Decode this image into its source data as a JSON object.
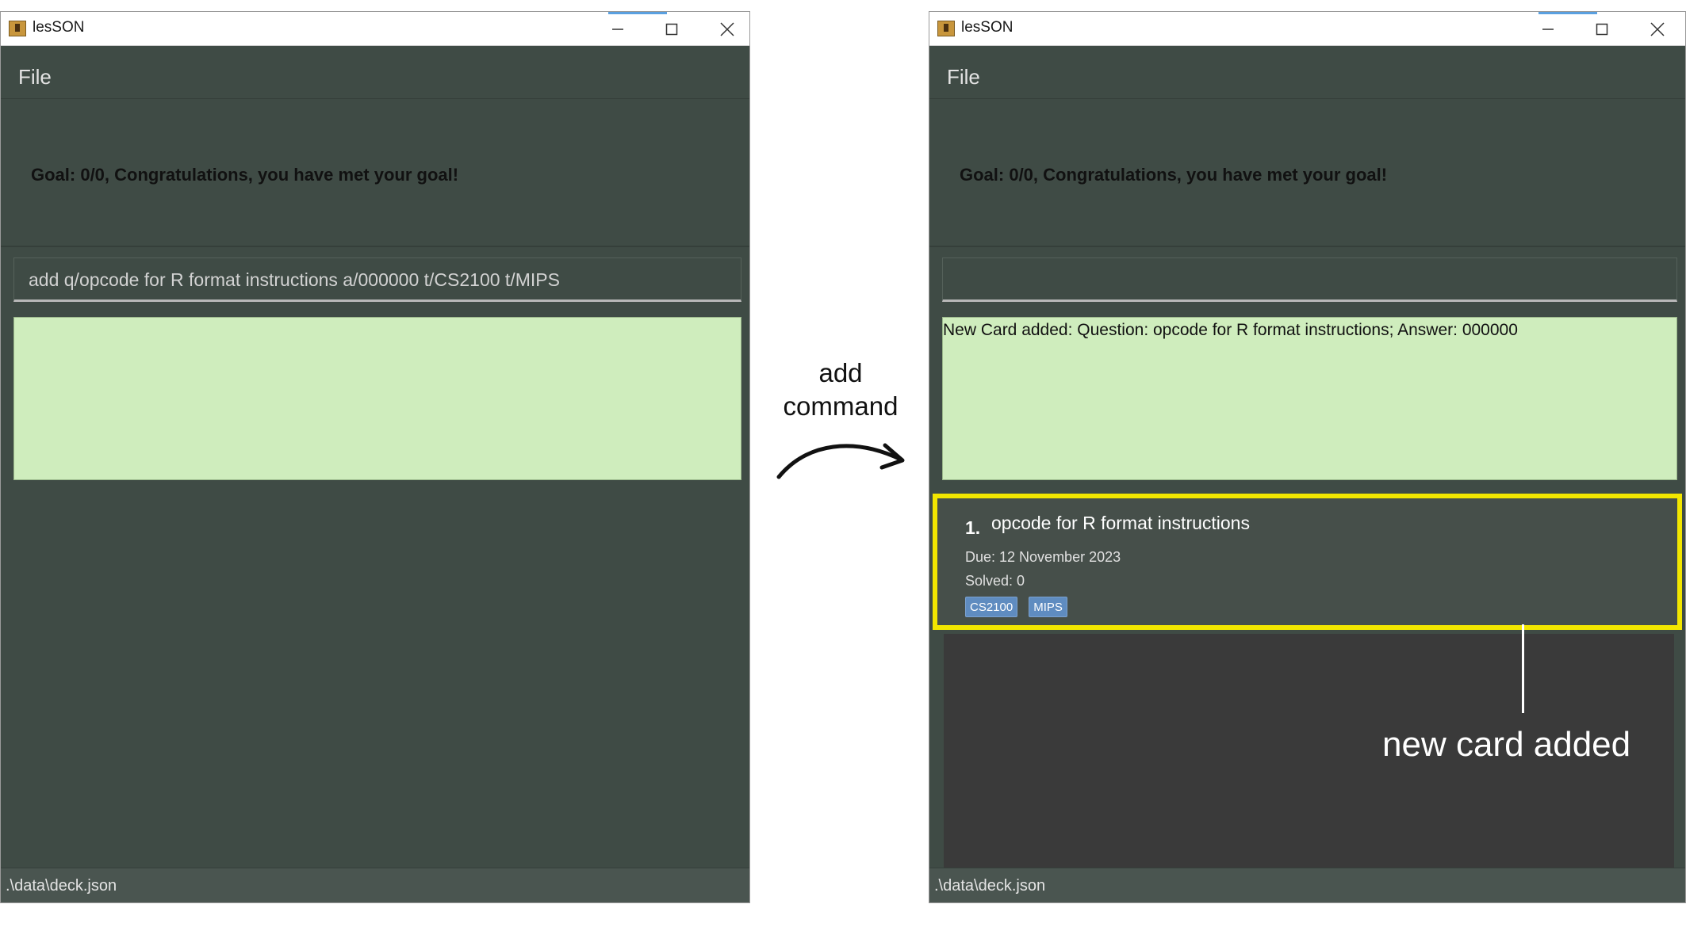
{
  "app": {
    "window_title": "lesSON",
    "menu_file": "File"
  },
  "goal_text": "Goal: 0/0, Congratulations, you have met your goal!",
  "left_window": {
    "command_input": "add q/opcode for R format instructions a/000000 t/CS2100 t/MIPS",
    "result_text": ""
  },
  "right_window": {
    "command_input": "",
    "result_text": "New Card added: Question: opcode for R format instructions; Answer: 000000",
    "card": {
      "index": "1.",
      "question": "opcode for R format instructions",
      "due": "Due: 12 November 2023",
      "solved": "Solved: 0",
      "tags": [
        "CS2100",
        "MIPS"
      ]
    }
  },
  "status_path": ".\\data\\deck.json",
  "annotations": {
    "arrow_label_line1": "add",
    "arrow_label_line2": "command",
    "new_card_label": "new card added"
  },
  "colors": {
    "window_bg": "#3f4b45",
    "result_bg": "#cfedbd",
    "highlight_border": "#f2e600",
    "tag_bg": "#5f8cc0"
  },
  "icons": [
    "app-icon",
    "minimize-icon",
    "maximize-icon",
    "close-icon",
    "curved-arrow-icon"
  ]
}
